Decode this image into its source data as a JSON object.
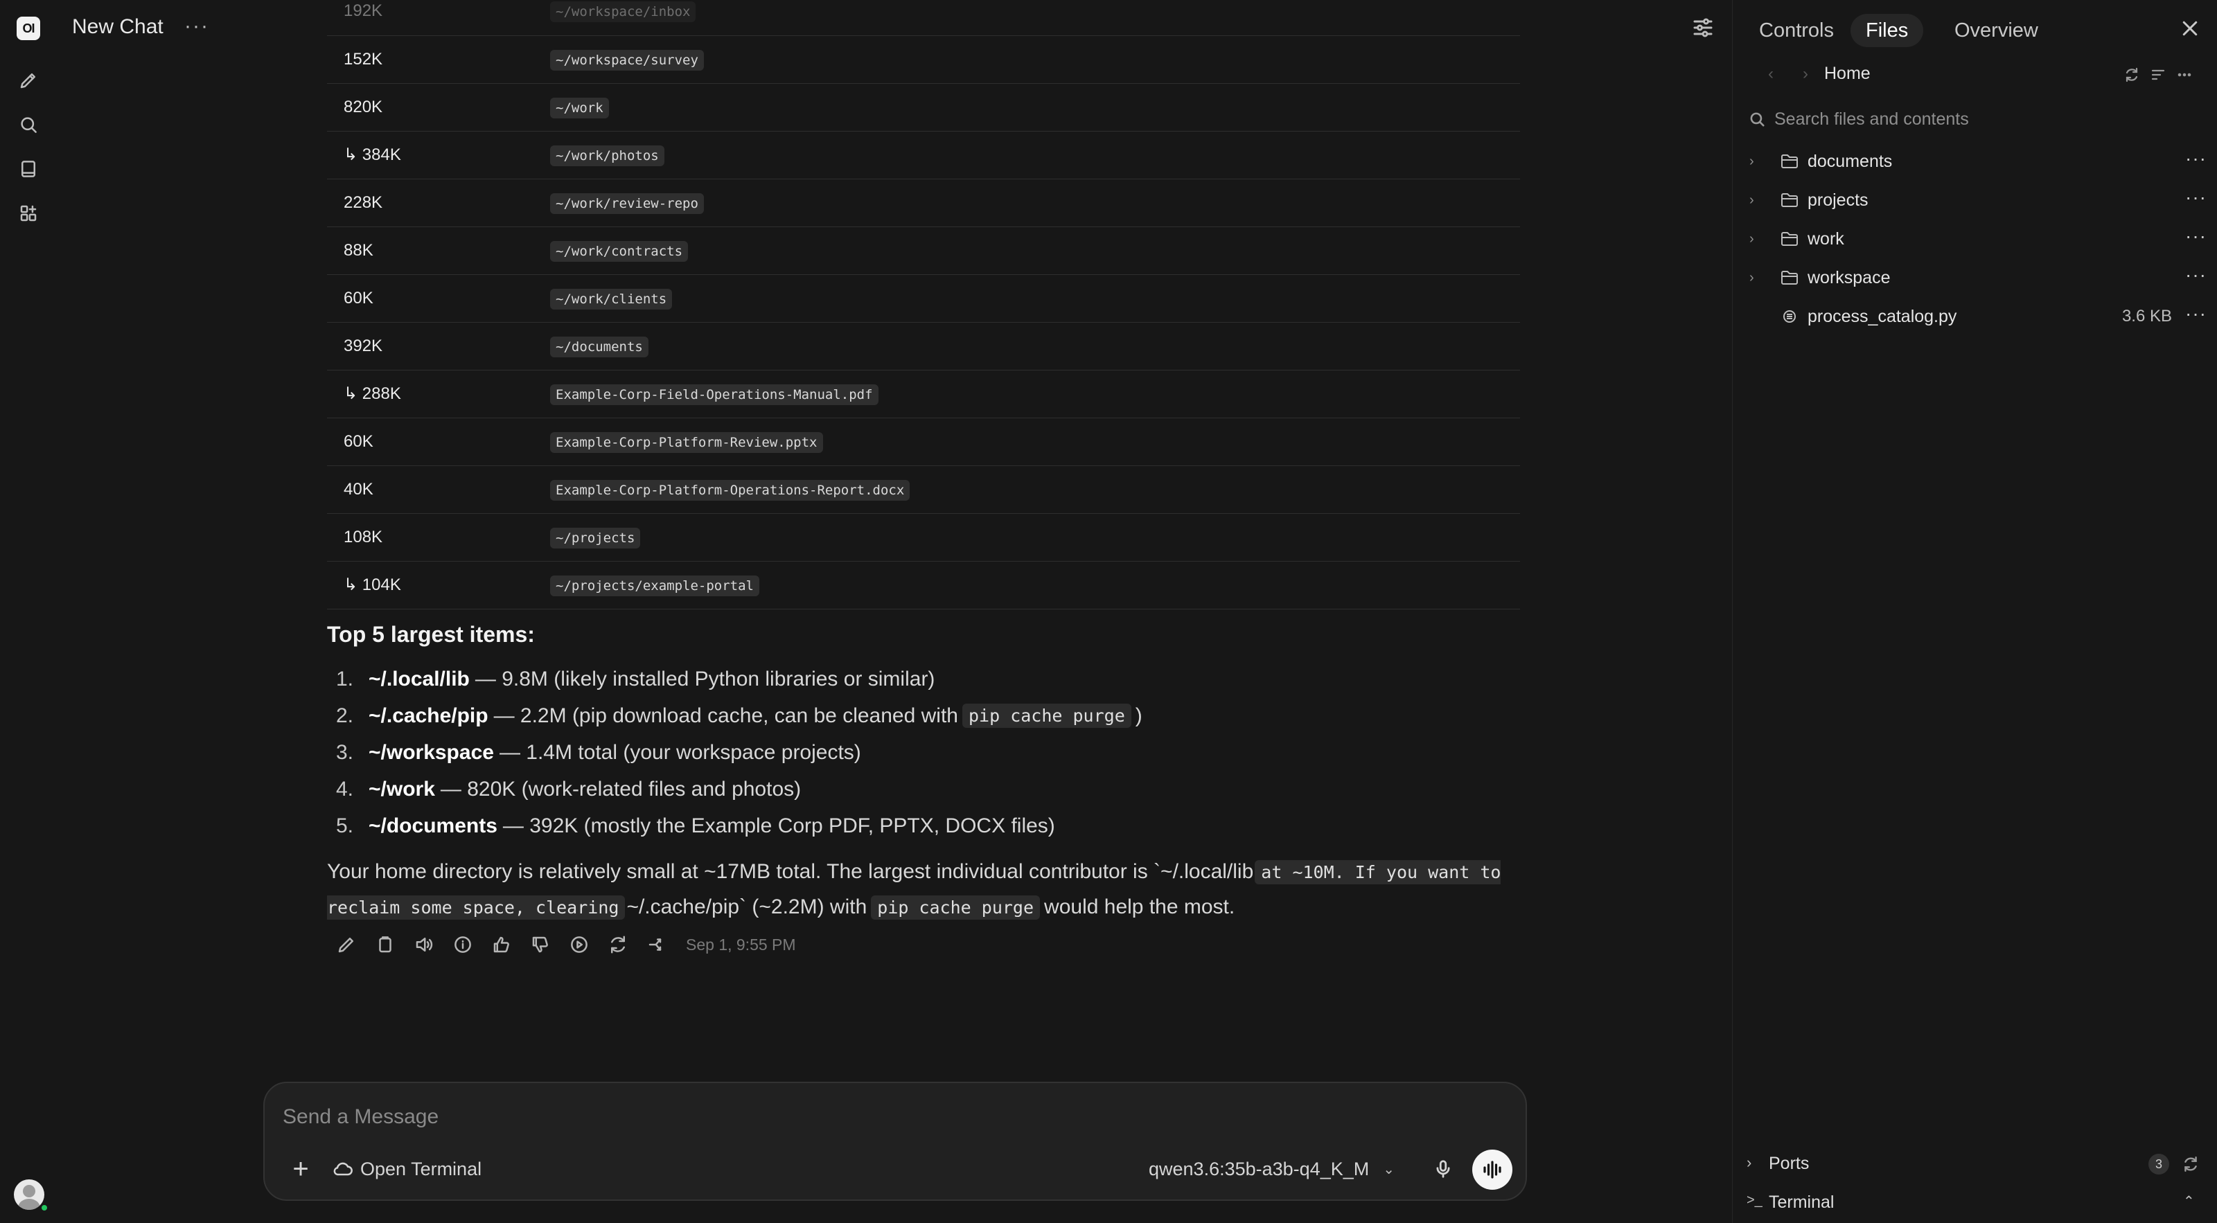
{
  "app": {
    "logo_text": "OI"
  },
  "header": {
    "title": "New Chat",
    "menu_glyph": "···"
  },
  "disk_table": {
    "rows": [
      {
        "size": "192K",
        "path": "~/workspace/inbox",
        "faded": true
      },
      {
        "size": "152K",
        "path": "~/workspace/survey"
      },
      {
        "size": "820K",
        "path": "~/work"
      },
      {
        "size": "↳ 384K",
        "path": "~/work/photos"
      },
      {
        "size": "228K",
        "path": "~/work/review-repo"
      },
      {
        "size": "88K",
        "path": "~/work/contracts"
      },
      {
        "size": "60K",
        "path": "~/work/clients"
      },
      {
        "size": "392K",
        "path": "~/documents"
      },
      {
        "size": "↳ 288K",
        "path": "Example-Corp-Field-Operations-Manual.pdf"
      },
      {
        "size": "60K",
        "path": "Example-Corp-Platform-Review.pptx"
      },
      {
        "size": "40K",
        "path": "Example-Corp-Platform-Operations-Report.docx"
      },
      {
        "size": "108K",
        "path": "~/projects"
      },
      {
        "size": "↳ 104K",
        "path": "~/projects/example-portal"
      }
    ]
  },
  "top5": {
    "heading": "Top 5 largest items:",
    "items": [
      {
        "num": "1.",
        "name": "~/.local/lib",
        "text": "— 9.8M (likely installed Python libraries or similar)"
      },
      {
        "num": "2.",
        "name": "~/.cache/pip",
        "text": "— 2.2M (pip download cache, can be cleaned with",
        "code": "pip cache purge",
        "after": ")"
      },
      {
        "num": "3.",
        "name": "~/workspace",
        "text": "— 1.4M total (your workspace projects)"
      },
      {
        "num": "4.",
        "name": "~/work",
        "text": "— 820K (work-related files and photos)"
      },
      {
        "num": "5.",
        "name": "~/documents",
        "text": "— 392K (mostly the Example Corp PDF, PPTX, DOCX files)"
      }
    ]
  },
  "summary": {
    "part1": "Your home directory is relatively small at ~17MB total. The largest individual contributor is `~/.local/lib",
    "code1": "at ~10M. If you want to reclaim some space, clearing",
    "part2": "~/.cache/pip` (~2.2M) with",
    "code2": "pip cache purge",
    "part3": "would help the most."
  },
  "message": {
    "timestamp": "Sep 1, 9:55 PM"
  },
  "composer": {
    "placeholder": "Send a Message",
    "attach_glyph": "+",
    "terminal_label": "Open Terminal",
    "model": "qwen3.6:35b-a3b-q4_K_M"
  },
  "panel": {
    "tabs": [
      "Controls",
      "Files",
      "Overview"
    ],
    "active_tab": "Files",
    "breadcrumb": "Home",
    "search_placeholder": "Search files and contents",
    "entries": [
      {
        "name": "documents",
        "type": "folder"
      },
      {
        "name": "projects",
        "type": "folder"
      },
      {
        "name": "work",
        "type": "folder"
      },
      {
        "name": "workspace",
        "type": "folder"
      },
      {
        "name": "process_catalog.py",
        "type": "file",
        "size": "3.6 KB"
      }
    ],
    "ports_label": "Ports",
    "ports_count": "3",
    "terminal_label": "Terminal"
  },
  "colors": {
    "background": "#171717",
    "accent_white": "#f5f5f5",
    "online": "#22c55e"
  }
}
